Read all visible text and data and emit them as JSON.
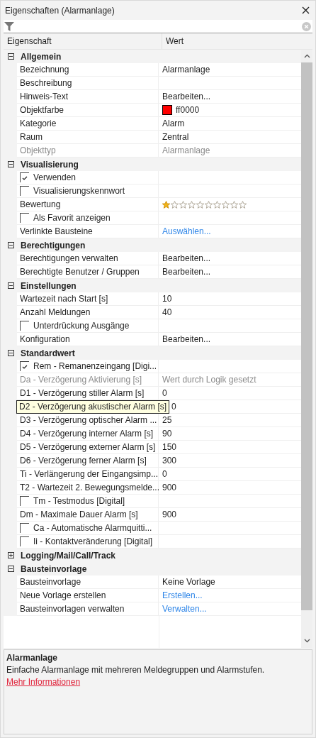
{
  "window": {
    "title": "Eigenschaften (Alarmanlage)"
  },
  "columns": [
    "Eigenschaft",
    "Wert"
  ],
  "groups": [
    {
      "title": "Allgemein",
      "expanded": true,
      "rows": [
        {
          "kind": "text",
          "label": "Bezeichnung",
          "value": "Alarmanlage",
          "disabled": false
        },
        {
          "kind": "text",
          "label": "Beschreibung",
          "disabled": false
        },
        {
          "kind": "text",
          "label": "Hinweis-Text",
          "value": "Bearbeiten...",
          "disabled": false
        },
        {
          "kind": "color",
          "label": "Objektfarbe",
          "value": "ff0000",
          "color": "#ff0000",
          "disabled": false
        },
        {
          "kind": "text",
          "label": "Kategorie",
          "value": "Alarm",
          "disabled": false
        },
        {
          "kind": "text",
          "label": "Raum",
          "value": "Zentral",
          "disabled": false
        },
        {
          "kind": "text",
          "label": "Objekttyp",
          "value": "Alarmanlage",
          "disabled": true
        }
      ]
    },
    {
      "title": "Visualisierung",
      "expanded": true,
      "rows": [
        {
          "kind": "check",
          "label": "Verwenden",
          "checked": true,
          "disabled": false
        },
        {
          "kind": "check",
          "label": "Visualisierungskennwort",
          "checked": false,
          "disabled": false
        },
        {
          "kind": "stars",
          "label": "Bewertung",
          "stars": 1,
          "disabled": false
        },
        {
          "kind": "check",
          "label": "Als Favorit anzeigen",
          "checked": false,
          "disabled": false
        },
        {
          "kind": "link",
          "label": "Verlinkte Bausteine",
          "value": "Auswählen...",
          "disabled": false
        }
      ]
    },
    {
      "title": "Berechtigungen",
      "expanded": true,
      "rows": [
        {
          "kind": "text",
          "label": "Berechtigungen verwalten",
          "value": "Bearbeiten...",
          "disabled": false
        },
        {
          "kind": "text",
          "label": "Berechtigte Benutzer / Gruppen",
          "value": "Bearbeiten...",
          "disabled": false
        }
      ]
    },
    {
      "title": "Einstellungen",
      "expanded": true,
      "rows": [
        {
          "kind": "text",
          "label": "Wartezeit nach Start [s]",
          "value": "10",
          "disabled": false
        },
        {
          "kind": "text",
          "label": "Anzahl Meldungen",
          "value": "40",
          "disabled": false
        },
        {
          "kind": "check",
          "label": "Unterdrückung Ausgänge",
          "checked": false,
          "disabled": false
        },
        {
          "kind": "text",
          "label": "Konfiguration",
          "value": "Bearbeiten...",
          "disabled": false
        }
      ]
    },
    {
      "title": "Standardwert",
      "expanded": true,
      "rows": [
        {
          "kind": "check",
          "label": "Rem - Remanenzeingang [Digi...",
          "checked": true,
          "disabled": false
        },
        {
          "kind": "text",
          "label": "Da - Verzögerung Aktivierung [s]",
          "value": "Wert durch Logik gesetzt",
          "disabled": true
        },
        {
          "kind": "text",
          "label": "D1 - Verzögerung stiller Alarm [s]",
          "value": "0",
          "disabled": false
        },
        {
          "kind": "tooltip",
          "label": "D2 - Verzögerung akustischer Alarm [s]",
          "value": "0",
          "disabled": false
        },
        {
          "kind": "text",
          "label": "D3 - Verzögerung optischer Alarm ...",
          "value": "25",
          "disabled": false
        },
        {
          "kind": "text",
          "label": "D4 - Verzögerung interner Alarm [s]",
          "value": "90",
          "disabled": false
        },
        {
          "kind": "text",
          "label": "D5 - Verzögerung externer Alarm [s]",
          "value": "150",
          "disabled": false
        },
        {
          "kind": "text",
          "label": "D6 - Verzögerung ferner Alarm [s]",
          "value": "300",
          "disabled": false
        },
        {
          "kind": "text",
          "label": "Ti - Verlängerung der Eingangsimp...",
          "value": "0",
          "disabled": false
        },
        {
          "kind": "text",
          "label": "T2 - Wartezeit 2. Bewegungsmelde...",
          "value": "900",
          "disabled": false
        },
        {
          "kind": "check",
          "label": "Tm - Testmodus [Digital]",
          "checked": false,
          "disabled": false
        },
        {
          "kind": "text",
          "label": "Dm - Maximale Dauer Alarm [s]",
          "value": "900",
          "disabled": false
        },
        {
          "kind": "check",
          "label": "Ca - Automatische Alarmquitti...",
          "checked": false,
          "disabled": false
        },
        {
          "kind": "check",
          "label": "Ii - Kontaktveränderung [Digital]",
          "checked": false,
          "disabled": false
        }
      ]
    },
    {
      "title": "Logging/Mail/Call/Track",
      "expanded": false
    },
    {
      "title": "Bausteinvorlage",
      "expanded": true,
      "rows": [
        {
          "kind": "text",
          "label": "Bausteinvorlage",
          "value": "Keine Vorlage",
          "disabled": false
        },
        {
          "kind": "link",
          "label": "Neue Vorlage erstellen",
          "value": "Erstellen...",
          "disabled": false
        },
        {
          "kind": "link",
          "label": "Bausteinvorlagen verwalten",
          "value": "Verwalten...",
          "disabled": false
        }
      ]
    }
  ],
  "description": {
    "title": "Alarmanlage",
    "text": "Einfache Alarmanlage mit mehreren Meldegruppen und Alarmstufen.",
    "link": "Mehr Informationen"
  }
}
